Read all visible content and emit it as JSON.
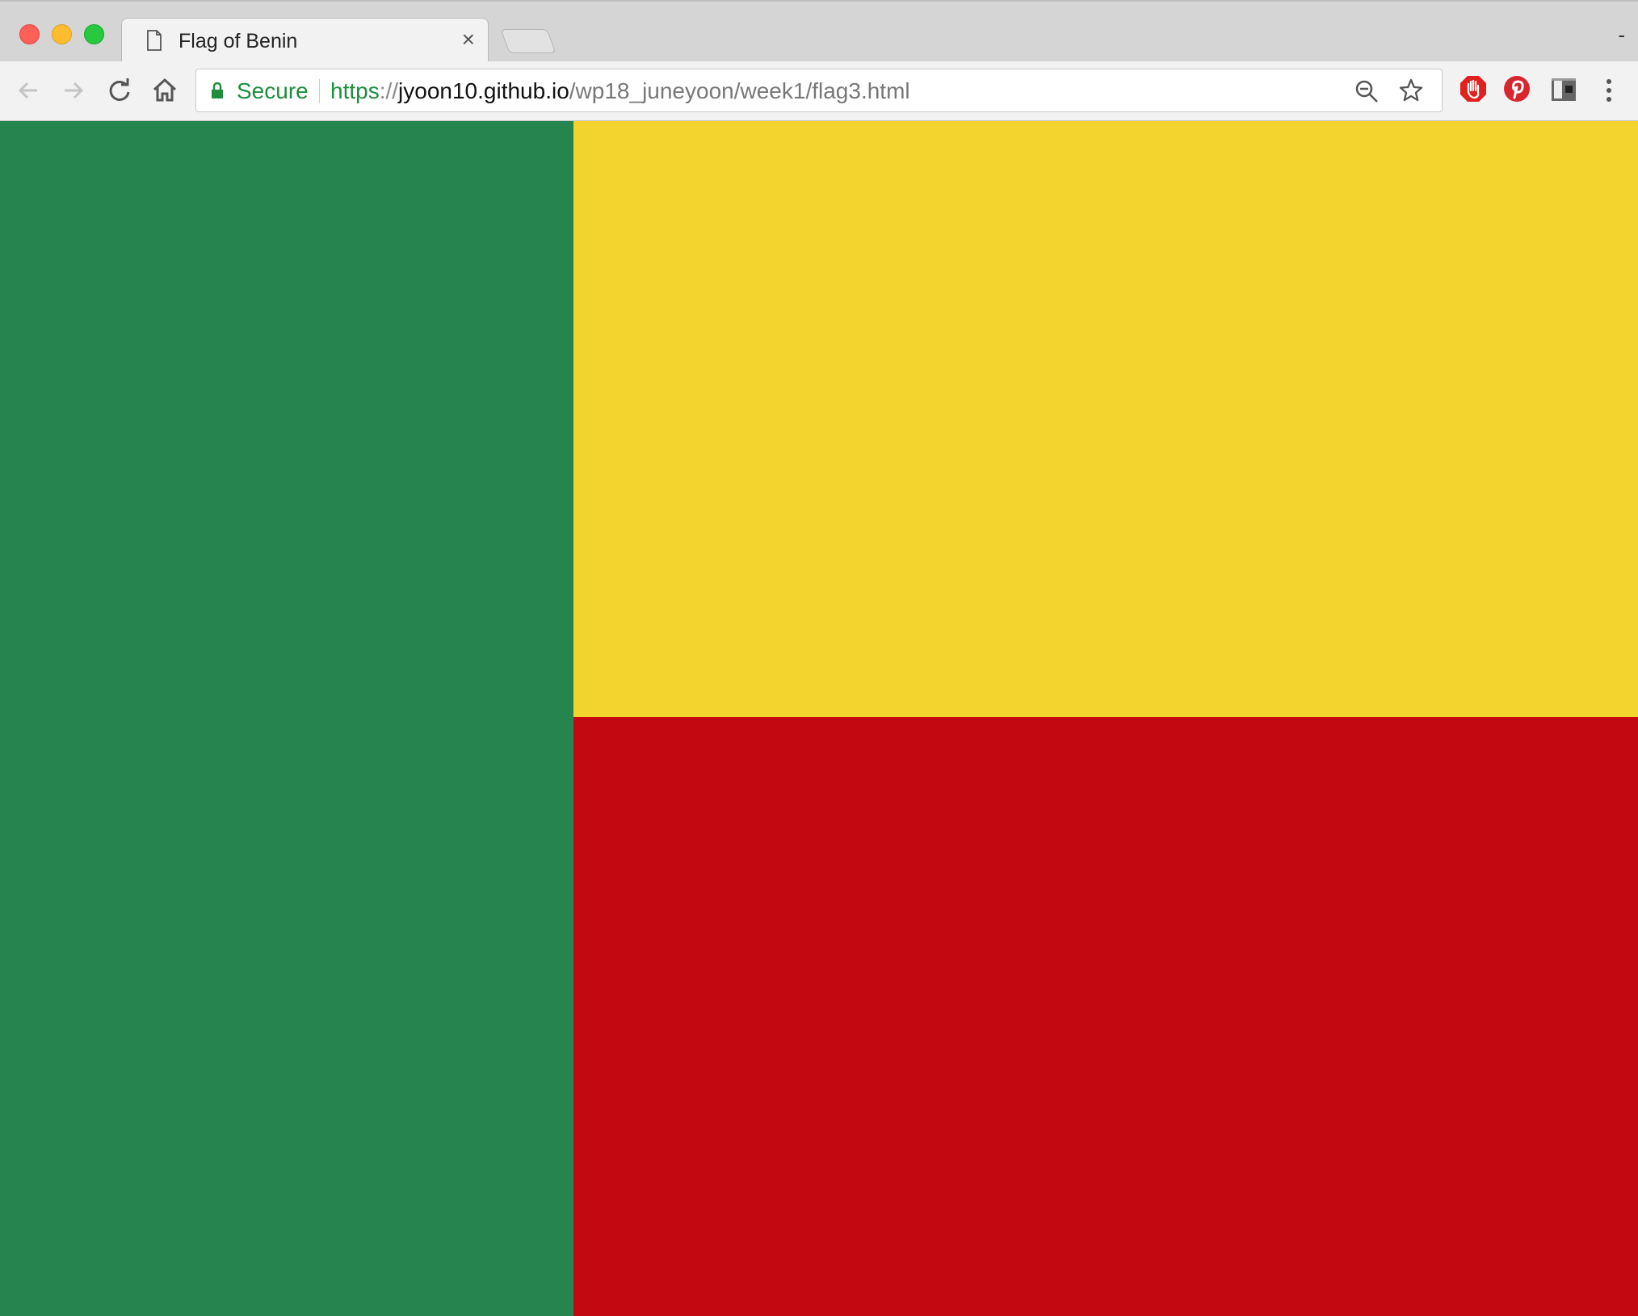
{
  "browser": {
    "tab_title": "Flag of Benin",
    "tab_close": "×",
    "window_control": "-",
    "secure_label": "Secure",
    "url": {
      "scheme": "https",
      "separator": "://",
      "host": "jyoon10.github.io",
      "path": "/wp18_juneyoon/week1/flag3.html"
    },
    "icons": {
      "back": "back-arrow-icon",
      "forward": "forward-arrow-icon",
      "reload": "reload-icon",
      "home": "home-icon",
      "lock": "lock-icon",
      "zoom": "zoom-out-icon",
      "bookmark": "star-icon",
      "extensions": [
        "stop-hand-icon",
        "pinterest-icon",
        "extension-box-icon"
      ],
      "menu": "kebab-menu-icon"
    }
  },
  "flag": {
    "colors": {
      "green": "#26844f",
      "yellow": "#f3d42e",
      "red": "#c30811"
    }
  }
}
